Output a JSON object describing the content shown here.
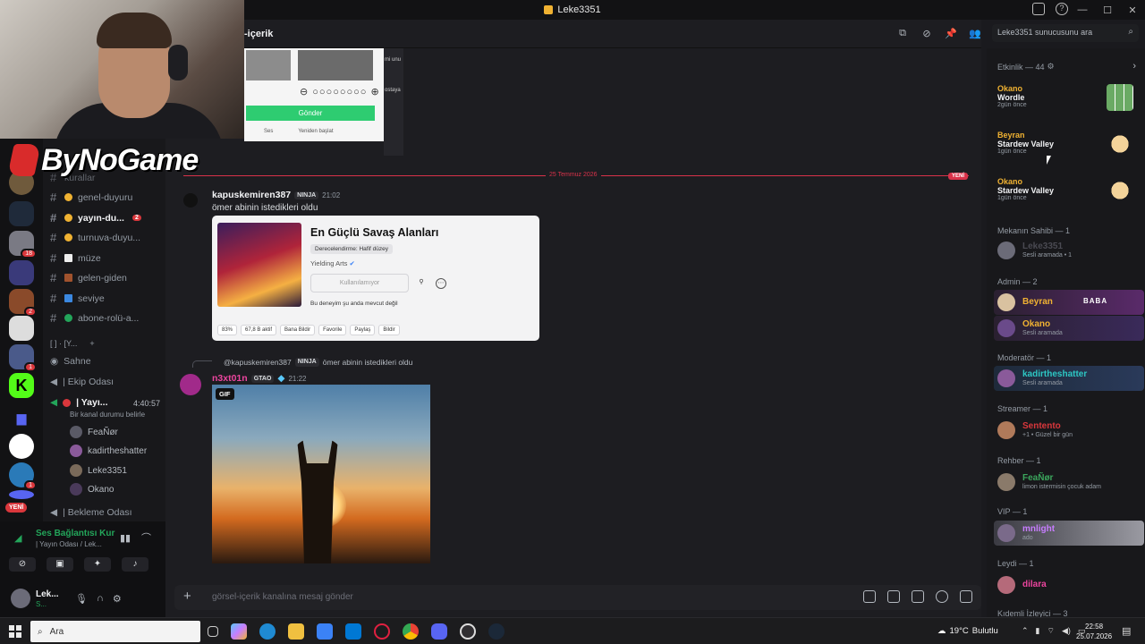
{
  "window": {
    "title": "Leke3351"
  },
  "overlay": {
    "brand": "ByNoGame"
  },
  "channels": [
    {
      "name": "kurallar",
      "icon": "hash",
      "dim": true
    },
    {
      "name": "genel-duyuru",
      "icon": "bell"
    },
    {
      "name": "yayın-du...",
      "icon": "bell",
      "unread": true,
      "count": "2"
    },
    {
      "name": "turnuva-duyu...",
      "icon": "bell"
    },
    {
      "name": "müze",
      "icon": "frame"
    },
    {
      "name": "gelen-giden",
      "icon": "door"
    },
    {
      "name": "seviye",
      "icon": "chart"
    },
    {
      "name": "abone-rolü-a...",
      "icon": "green-dot"
    }
  ],
  "sidebar_sections": {
    "category": "[ ] · [Y...",
    "stage": "Sahne",
    "ekip": "| Ekip Odası",
    "live_channel": "| Yayı...",
    "live_timer": "4:40:57",
    "live_status": "Bir kanal durumu belirle",
    "bekleme": "| Bekleme Odası"
  },
  "voice_users": [
    "FeaÑør",
    "kadirtheshatter",
    "Leke3351",
    "Okano"
  ],
  "voice_connection": {
    "title": "Ses Bağlantısı Kur",
    "subtitle": "| Yayın Odası / Lek..."
  },
  "user_panel": {
    "name": "Lek...",
    "status": "S..."
  },
  "rail_new": "YENİ",
  "rail_badges": [
    "18",
    "2",
    "1",
    "1",
    "1"
  ],
  "chat": {
    "channel": "-içerik",
    "date_divider": "25 Temmuz 2026",
    "new_tag": "YENİ",
    "captcha": {
      "submit": "Gönder",
      "sound": "Ses",
      "restart": "Yeniden başlat",
      "side1": "mi unu",
      "side2": "ostaya"
    },
    "messages": [
      {
        "author": "kapuskemiren387",
        "tag": "NINJA",
        "time": "21:02",
        "text": "ömer abinin istedikleri oldu",
        "embed": {
          "title": "En Güçlü Savaş Alanları",
          "rating": "Derecelendirme: Hafif düzey",
          "developer": "Yielding Arts",
          "button": "Kullanılamıyor",
          "availability": "Bu deneyim şu anda mevcut değil",
          "chips": [
            "83%",
            "67,8 B aktif",
            "Bana Bildir",
            "Favorile",
            "Paylaş",
            "Bildir"
          ]
        }
      },
      {
        "reply_to": "@kapuskemiren387",
        "reply_tag": "NINJA",
        "reply_text": "ömer abinin istedikleri oldu",
        "author": "n3xt01n",
        "tag": "GTAO",
        "time": "21:22",
        "gif_label": "GIF"
      }
    ],
    "composer_placeholder": "görsel-içerik kanalına mesaj gönder"
  },
  "members": {
    "search_placeholder": "Leke3351 sunucusunu ara",
    "activity_header": "Etkinlik — 44",
    "activities": [
      {
        "user": "Okano",
        "game": "Wordle",
        "when": "2gün önce"
      },
      {
        "user": "Beyran",
        "game": "Stardew Valley",
        "when": "1gün önce"
      },
      {
        "user": "Okano",
        "game": "Stardew Valley",
        "when": "1gün önce"
      }
    ],
    "groups": [
      {
        "title": "Mekanın Sahibi — 1",
        "members": [
          {
            "name": "Leke3351",
            "status": "Sesli aramada • 1",
            "color": "#4a4a52"
          }
        ]
      },
      {
        "title": "Admin — 2",
        "members": [
          {
            "name": "Beyran",
            "status": "",
            "color": "#f0b232",
            "extra": "BABA"
          },
          {
            "name": "Okano",
            "status": "Sesli aramada",
            "color": "#f0b232"
          }
        ]
      },
      {
        "title": "Moderatör — 1",
        "members": [
          {
            "name": "kadirtheshatter",
            "status": "Sesli aramada",
            "color": "#2dc7c4"
          }
        ]
      },
      {
        "title": "Streamer — 1",
        "members": [
          {
            "name": "Sentento",
            "status": "+1 • Güzel bir gün",
            "color": "#da373c"
          }
        ]
      },
      {
        "title": "Rehber — 1",
        "members": [
          {
            "name": "FeaÑør",
            "status": "limon istermisin çocuk adam",
            "color": "#3ba55c"
          }
        ]
      },
      {
        "title": "VIP — 1",
        "members": [
          {
            "name": "mnlight",
            "status": "ado",
            "color": "#c77dff"
          }
        ]
      },
      {
        "title": "Leydi — 1",
        "members": [
          {
            "name": "dilara",
            "status": "",
            "color": "#eb459e"
          }
        ]
      }
    ],
    "last_header": "Kıdemli İzleyici — 3"
  },
  "taskbar": {
    "search": "Ara",
    "weather": "19°C",
    "weather_desc": "Bulutlu",
    "time": "22:58",
    "date": "25.07.2026"
  }
}
